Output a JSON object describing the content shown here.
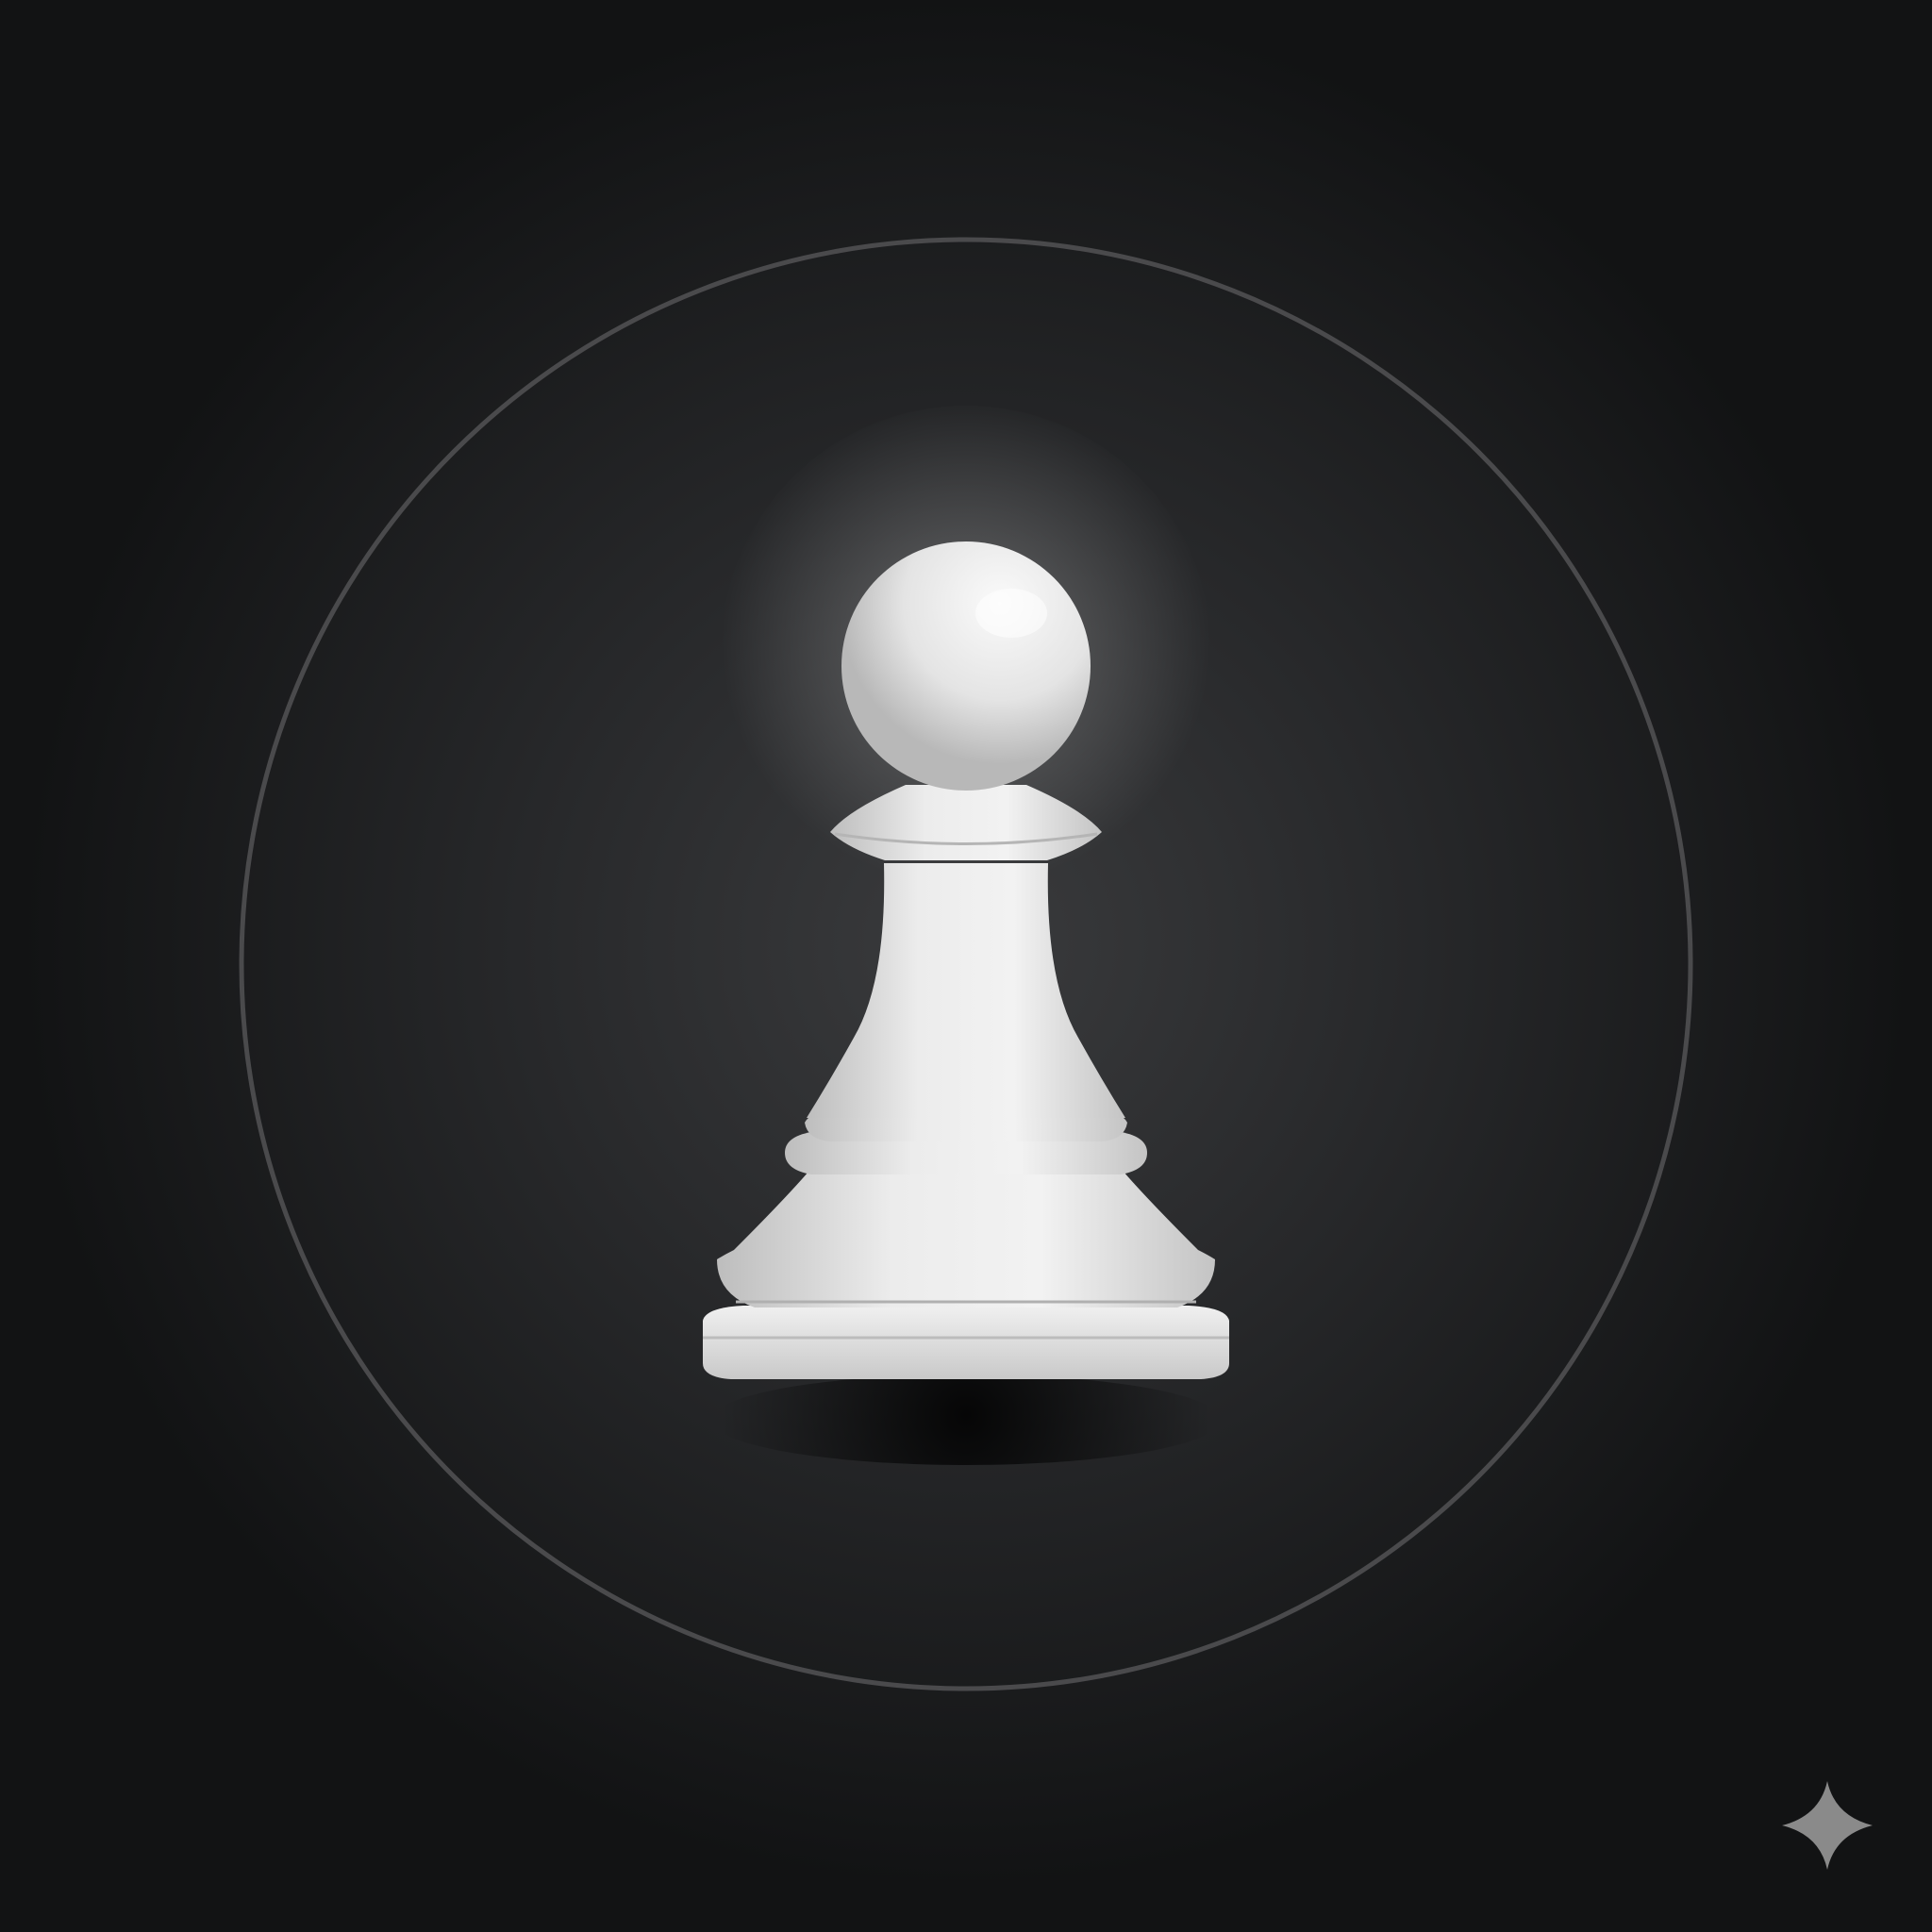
{
  "scene": {
    "subject": "chess-pawn",
    "background_color": "#121314",
    "glow_color": "#3a3b3d",
    "ring_color": "#4a4a4c",
    "piece_color": "#e6e6e6",
    "piece_shadow_color": "#9a9a9a",
    "sparkle_color": "#8a8a8a"
  }
}
